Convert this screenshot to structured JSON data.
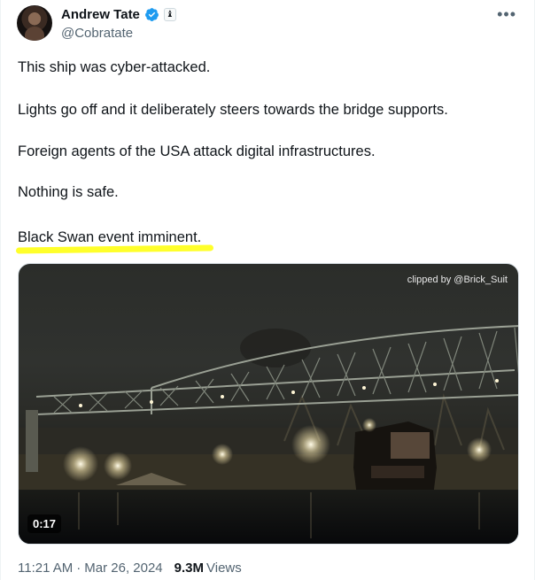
{
  "author": {
    "display_name": "Andrew Tate",
    "handle": "@Cobratate",
    "verified": true,
    "affiliation_icon": "chess-piece-icon"
  },
  "header": {
    "more_icon": "more-options-icon"
  },
  "tweet": {
    "lines": [
      "This ship was cyber-attacked.",
      "Lights go off and it deliberately steers towards the bridge supports.",
      "Foreign agents of the USA attack digital infrastructures.",
      "Nothing is safe.",
      "Black Swan event imminent."
    ],
    "highlight_color": "#ffff2a"
  },
  "media": {
    "clip_credit": "clipped by @Brick_Suit",
    "duration": "0:17"
  },
  "meta": {
    "time": "11:21 AM",
    "separator": "·",
    "date": "Mar 26, 2024",
    "views_count": "9.3M",
    "views_label": "Views"
  },
  "colors": {
    "text": "#0f1419",
    "secondary": "#536471",
    "verified": "#1d9bf0"
  }
}
